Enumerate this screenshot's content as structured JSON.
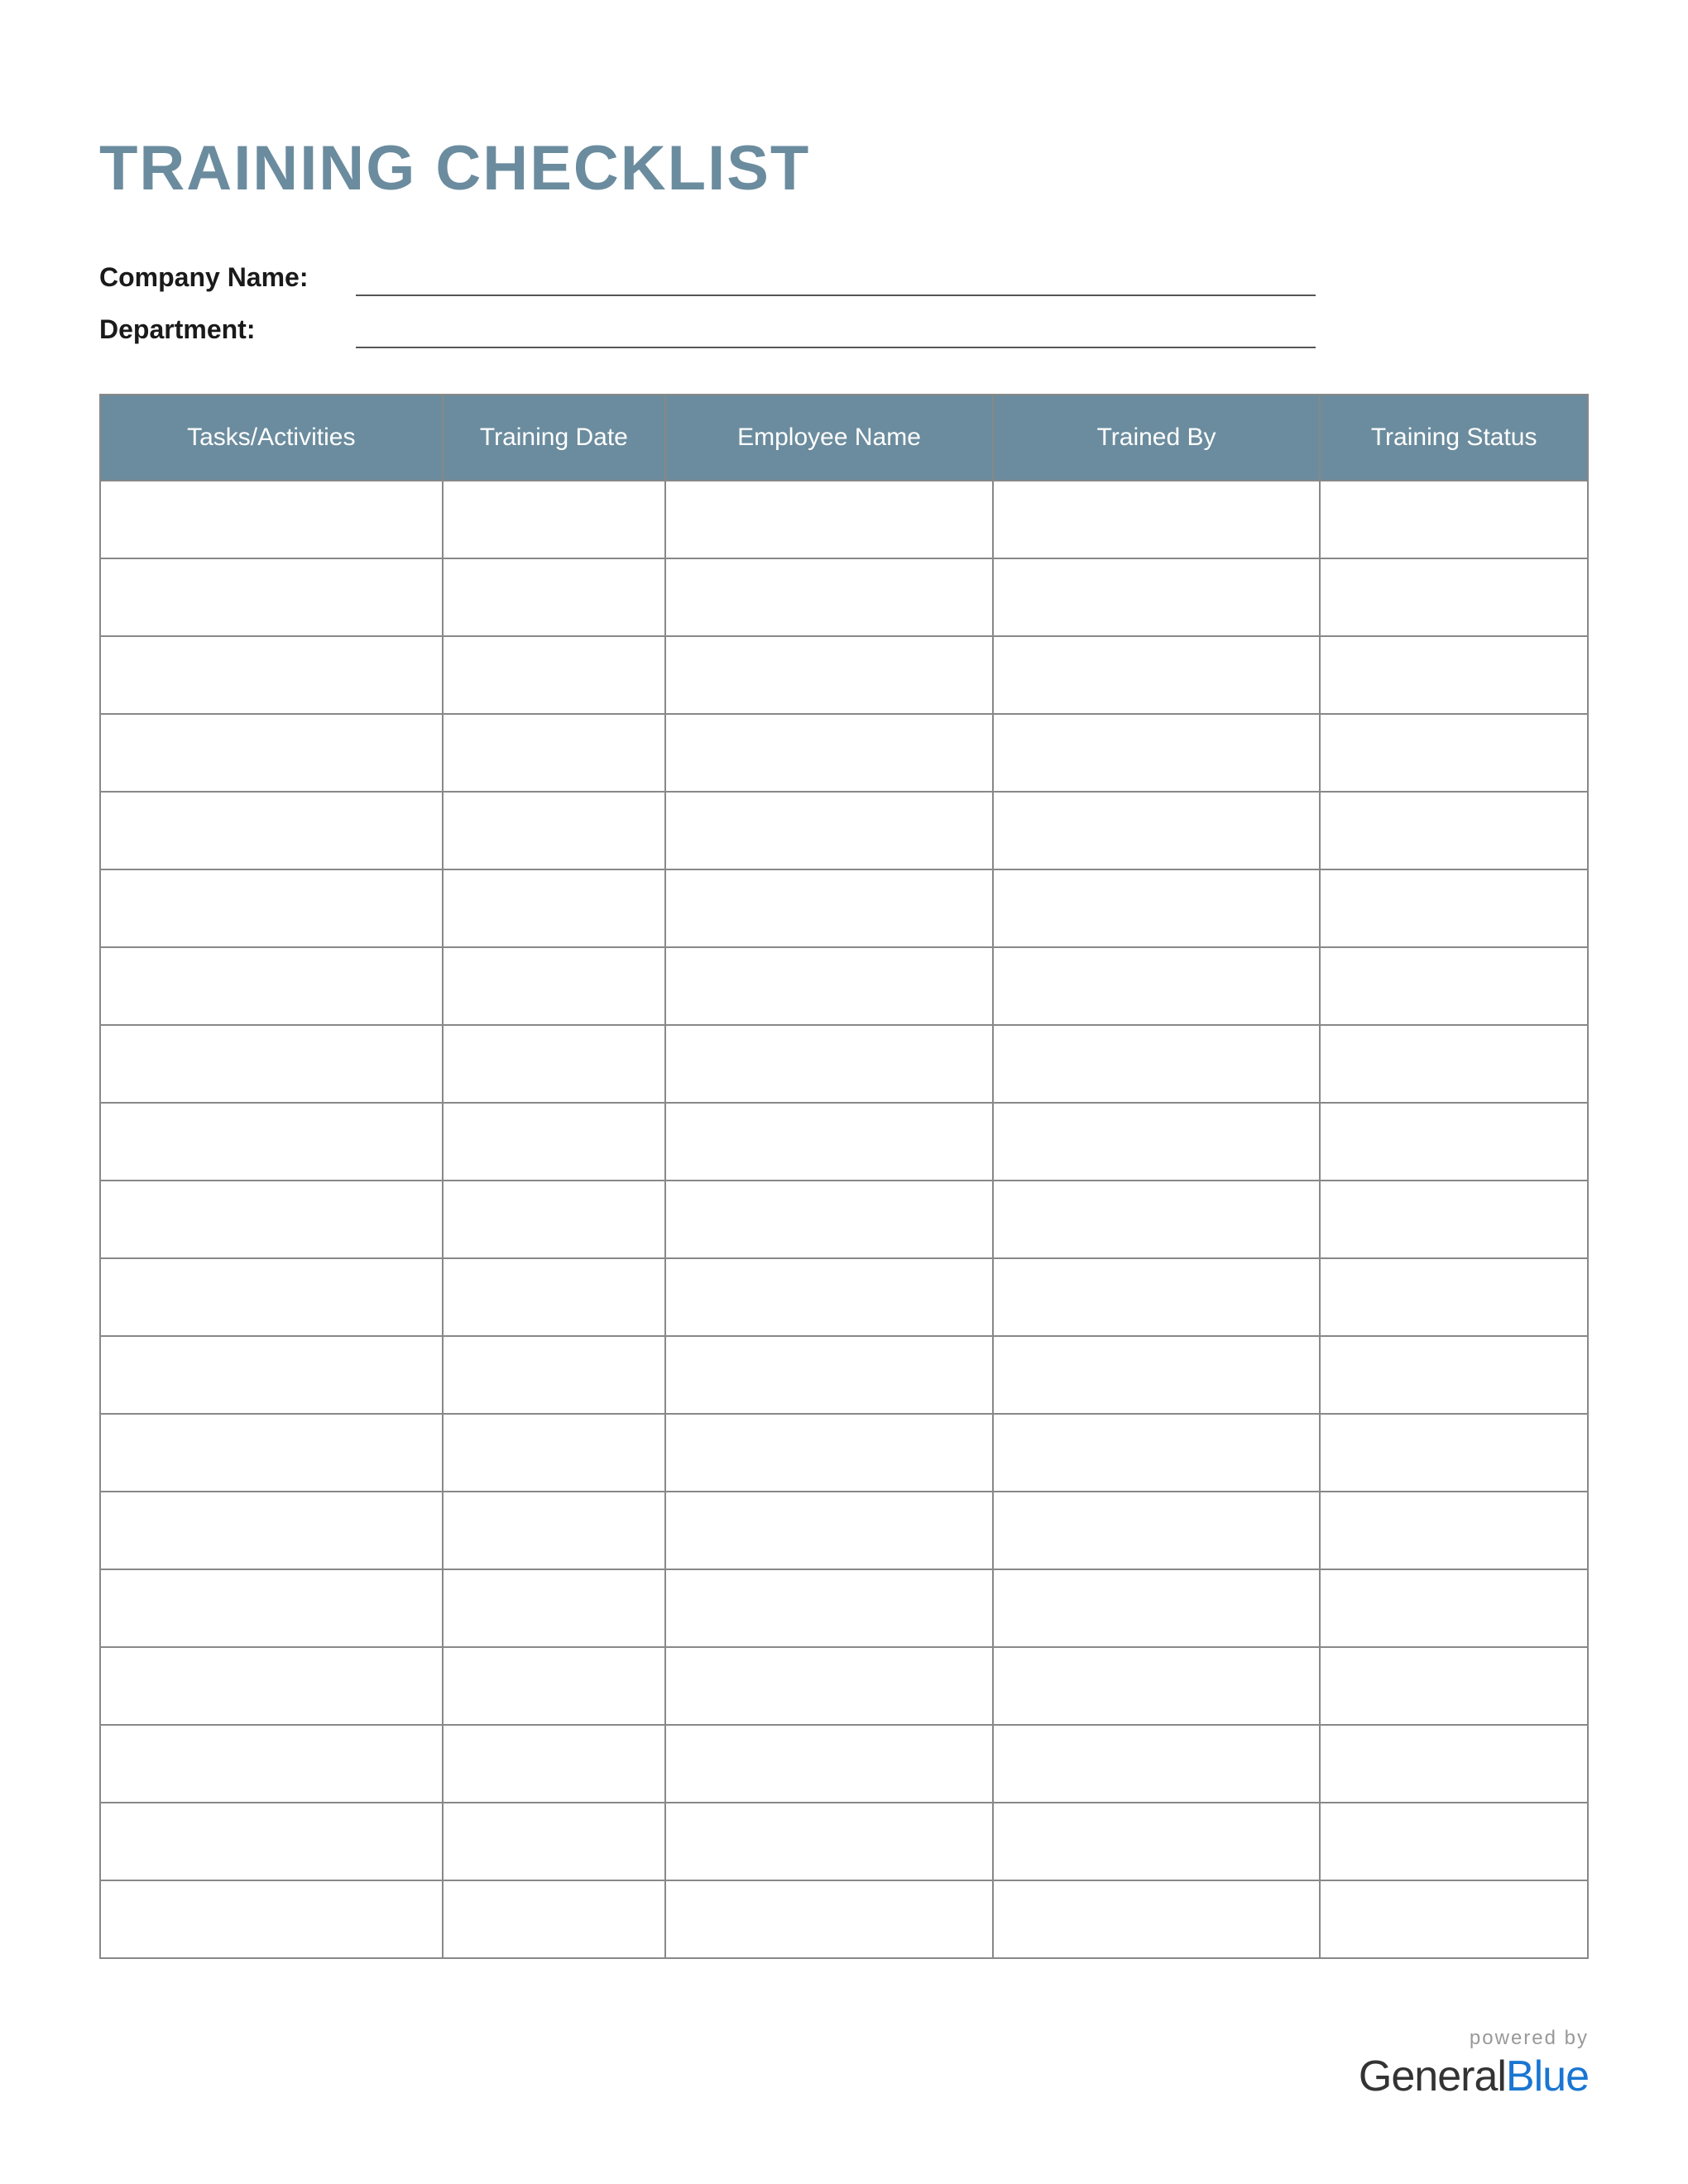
{
  "title": "TRAINING CHECKLIST",
  "info": {
    "company_label": "Company Name:",
    "company_value": "",
    "department_label": "Department:",
    "department_value": ""
  },
  "table": {
    "headers": {
      "task": "Tasks/Activities",
      "date": "Training Date",
      "employee": "Employee Name",
      "trainer": "Trained By",
      "status": "Training Status"
    },
    "rows": [
      {
        "task": "",
        "date": "",
        "employee": "",
        "trainer": "",
        "status": ""
      },
      {
        "task": "",
        "date": "",
        "employee": "",
        "trainer": "",
        "status": ""
      },
      {
        "task": "",
        "date": "",
        "employee": "",
        "trainer": "",
        "status": ""
      },
      {
        "task": "",
        "date": "",
        "employee": "",
        "trainer": "",
        "status": ""
      },
      {
        "task": "",
        "date": "",
        "employee": "",
        "trainer": "",
        "status": ""
      },
      {
        "task": "",
        "date": "",
        "employee": "",
        "trainer": "",
        "status": ""
      },
      {
        "task": "",
        "date": "",
        "employee": "",
        "trainer": "",
        "status": ""
      },
      {
        "task": "",
        "date": "",
        "employee": "",
        "trainer": "",
        "status": ""
      },
      {
        "task": "",
        "date": "",
        "employee": "",
        "trainer": "",
        "status": ""
      },
      {
        "task": "",
        "date": "",
        "employee": "",
        "trainer": "",
        "status": ""
      },
      {
        "task": "",
        "date": "",
        "employee": "",
        "trainer": "",
        "status": ""
      },
      {
        "task": "",
        "date": "",
        "employee": "",
        "trainer": "",
        "status": ""
      },
      {
        "task": "",
        "date": "",
        "employee": "",
        "trainer": "",
        "status": ""
      },
      {
        "task": "",
        "date": "",
        "employee": "",
        "trainer": "",
        "status": ""
      },
      {
        "task": "",
        "date": "",
        "employee": "",
        "trainer": "",
        "status": ""
      },
      {
        "task": "",
        "date": "",
        "employee": "",
        "trainer": "",
        "status": ""
      },
      {
        "task": "",
        "date": "",
        "employee": "",
        "trainer": "",
        "status": ""
      },
      {
        "task": "",
        "date": "",
        "employee": "",
        "trainer": "",
        "status": ""
      },
      {
        "task": "",
        "date": "",
        "employee": "",
        "trainer": "",
        "status": ""
      }
    ]
  },
  "footer": {
    "powered": "powered by",
    "brand_general": "General",
    "brand_blue": "Blue"
  },
  "colors": {
    "accent": "#6b8c9e",
    "brand_blue": "#1976d2"
  }
}
